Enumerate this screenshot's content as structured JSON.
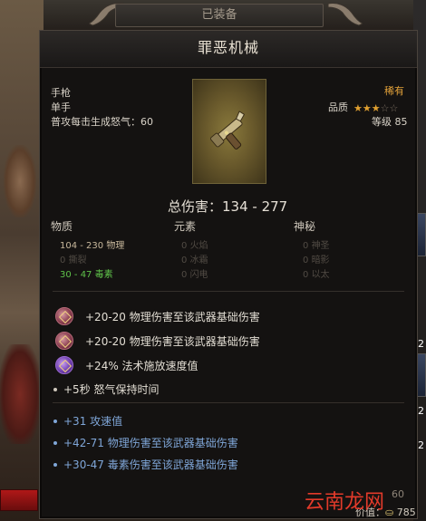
{
  "header": {
    "equipped_label": "已装备"
  },
  "item": {
    "name": "罪恶机械",
    "type": "手枪",
    "hand": "单手",
    "fury_text": "普攻每击生成怒气：60",
    "rarity": "稀有",
    "quality_label": "品质",
    "quality_stars": 3,
    "quality_max_stars": 5,
    "level_text": "等级 85",
    "icon": "pistol-icon"
  },
  "damage": {
    "total_label": "总伤害：",
    "total_value": "134 - 277",
    "columns": [
      "物质",
      "元素",
      "神秘"
    ],
    "physical": [
      {
        "value": "104 - 230",
        "name": "物理"
      },
      {
        "value": "0",
        "name": "撕裂"
      },
      {
        "value": "30 - 47",
        "name": "毒素"
      }
    ],
    "elemental": [
      {
        "value": "0",
        "name": "火焰"
      },
      {
        "value": "0",
        "name": "冰霜"
      },
      {
        "value": "0",
        "name": "闪电"
      }
    ],
    "mystic": [
      {
        "value": "0",
        "name": "神圣"
      },
      {
        "value": "0",
        "name": "暗影"
      },
      {
        "value": "0",
        "name": "以太"
      }
    ]
  },
  "gem_affixes": [
    {
      "text": "+20-20 物理伤害至该武器基础伤害",
      "gem": "fire-gem-icon"
    },
    {
      "text": "+20-20 物理伤害至该武器基础伤害",
      "gem": "fire-gem-icon"
    },
    {
      "text": "+24% 法术施放速度值",
      "gem": "arcane-gem-icon"
    }
  ],
  "base_affix": "+5秒 怒气保持时间",
  "blue_affixes": [
    "+31 攻速值",
    "+42-71 物理伤害至该武器基础伤害",
    "+30-47 毒素伤害至该武器基础伤害"
  ],
  "footer": {
    "gold_label": "价值：",
    "gold_value": "785",
    "corner_level": "60",
    "watermark": "云南龙网"
  },
  "side_numbers": [
    "2",
    "2",
    "2"
  ],
  "colors": {
    "rarity": "#e3a23a",
    "poison": "#5fc24a",
    "magic_blue": "#7fa6d8"
  }
}
